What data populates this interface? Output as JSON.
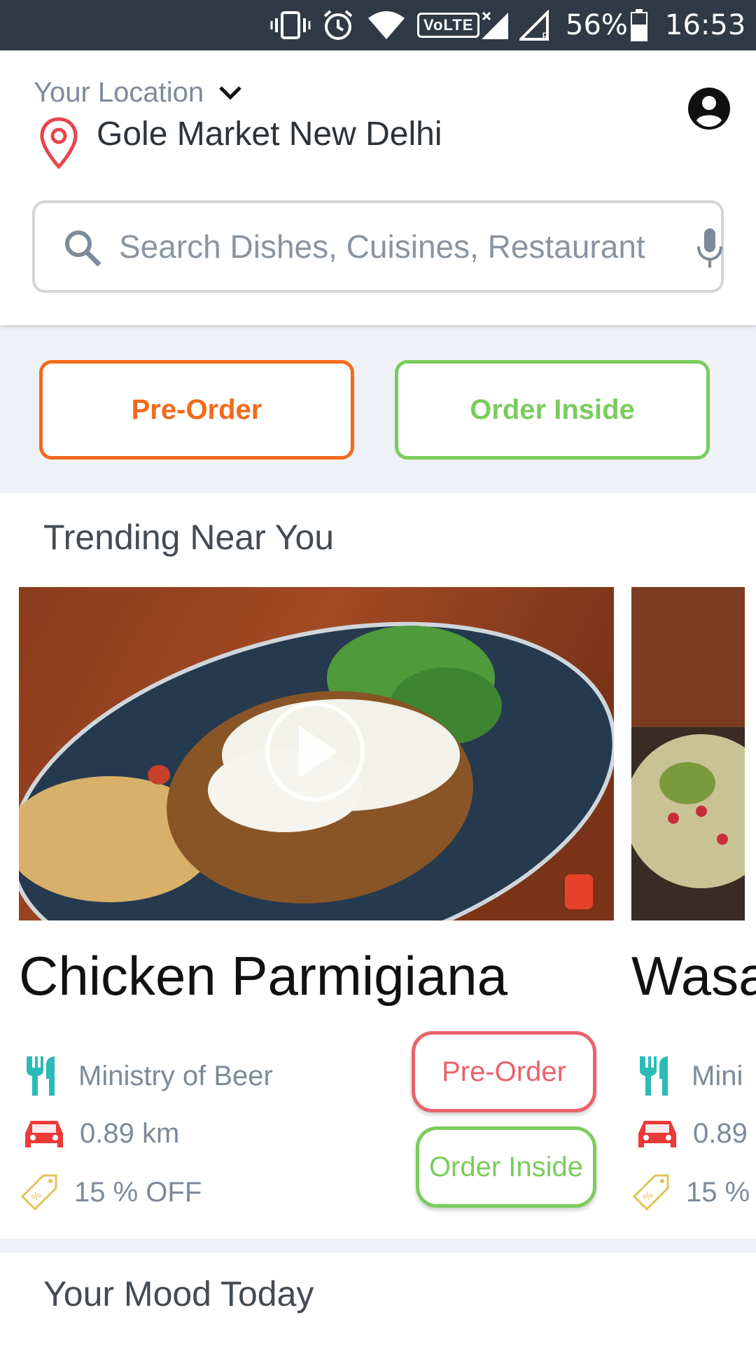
{
  "status_bar": {
    "battery": "56%",
    "time": "16:53",
    "volte": "VoLTE",
    "icons": [
      "vibrate-icon",
      "alarm-icon",
      "wifi-icon",
      "volte-icon",
      "signal-icon",
      "signal-roaming-icon",
      "battery-icon"
    ]
  },
  "header": {
    "location_label": "Your Location",
    "location_value": "Gole Market New Delhi",
    "search_placeholder": "Search Dishes, Cuisines, Restaurant"
  },
  "order_types": {
    "pre_order": "Pre-Order",
    "order_inside": "Order Inside"
  },
  "trending": {
    "title": "Trending Near You",
    "cards": [
      {
        "title": "Chicken Parmigiana",
        "restaurant": "Ministry of Beer",
        "distance": "0.89 km",
        "offer": "15 % OFF",
        "pre_order": "Pre-Order",
        "order_inside": "Order Inside"
      },
      {
        "title": "Wasa",
        "restaurant": "Mini",
        "distance": "0.89",
        "offer": "15 %"
      }
    ]
  },
  "mood": {
    "title": "Your Mood Today"
  },
  "colors": {
    "status_bar": "#2f3a46",
    "pre_order": "#f26a1b",
    "order_inside": "#7bcc5d",
    "card_pre_order": "#e9626e",
    "restaurant_icon": "#2bbbb6",
    "car_icon": "#ec3a3a",
    "tag_icon": "#e3c25a"
  }
}
